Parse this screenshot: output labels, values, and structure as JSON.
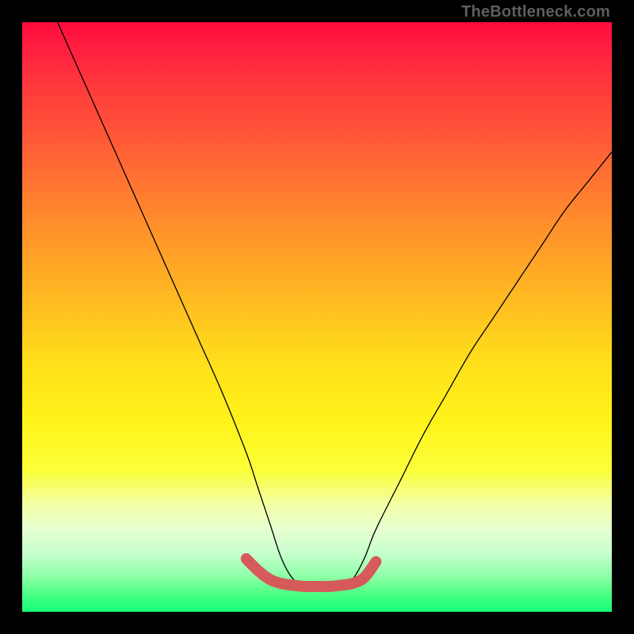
{
  "watermark": "TheBottleneck.com",
  "chart_data": {
    "type": "line",
    "title": "",
    "xlabel": "",
    "ylabel": "",
    "xlim": [
      0,
      100
    ],
    "ylim": [
      0,
      100
    ],
    "grid": false,
    "legend": false,
    "series": [
      {
        "name": "curve",
        "color": "#000000",
        "x": [
          6,
          10,
          14,
          18,
          22,
          26,
          30,
          34,
          38,
          40,
          42,
          44,
          46,
          48,
          50,
          52,
          54,
          56,
          58,
          60,
          64,
          68,
          72,
          76,
          80,
          84,
          88,
          92,
          96,
          100
        ],
        "y": [
          100,
          91,
          82,
          73,
          64,
          55,
          46,
          37,
          27,
          21,
          15,
          9,
          5.5,
          4.5,
          4.3,
          4.3,
          4.5,
          5.5,
          9,
          14,
          22,
          30,
          37,
          44,
          50,
          56,
          62,
          68,
          73,
          78
        ]
      },
      {
        "name": "highlight",
        "color": "#d65a5a",
        "x": [
          38,
          40,
          42,
          44,
          46,
          48,
          50,
          52,
          54,
          56,
          58,
          60
        ],
        "y": [
          9,
          7,
          5.5,
          4.8,
          4.5,
          4.3,
          4.3,
          4.3,
          4.5,
          4.8,
          5.8,
          8.5
        ]
      }
    ],
    "background_gradient": {
      "direction": "top-to-bottom",
      "stops": [
        {
          "pos": 0,
          "color": "#ff0b3d"
        },
        {
          "pos": 20,
          "color": "#ff5a37"
        },
        {
          "pos": 46,
          "color": "#ffb722"
        },
        {
          "pos": 68,
          "color": "#fff41a"
        },
        {
          "pos": 86,
          "color": "#e6ffd0"
        },
        {
          "pos": 100,
          "color": "#15ff77"
        }
      ]
    }
  }
}
